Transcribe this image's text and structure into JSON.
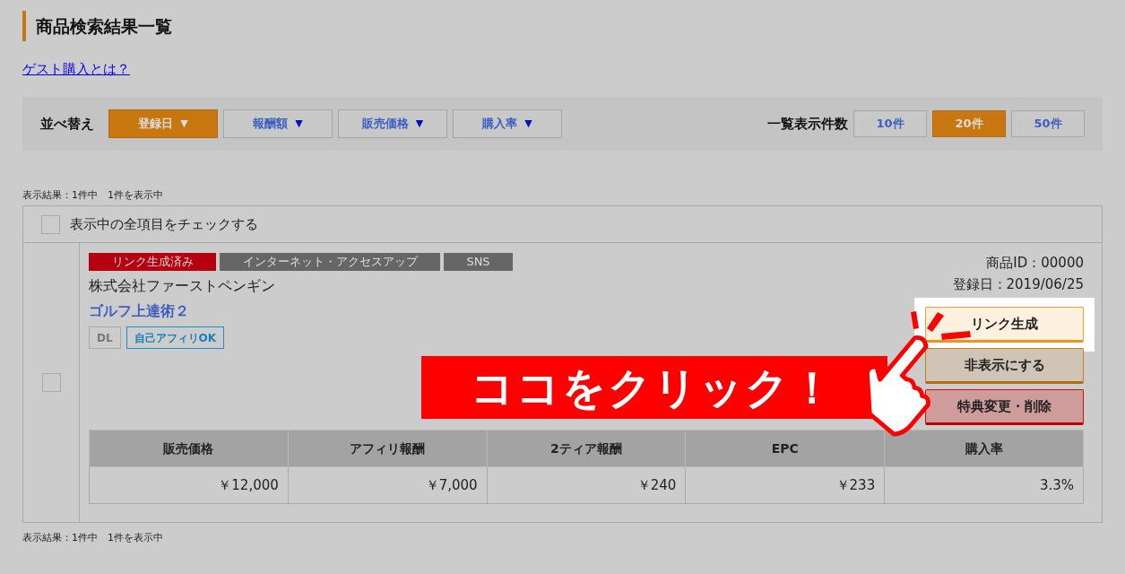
{
  "page_title": "商品検索結果一覧",
  "guest_link": "ゲスト購入とは？",
  "sort": {
    "label": "並べ替え",
    "options": [
      {
        "label": "登録日",
        "selected": true
      },
      {
        "label": "報酬額",
        "selected": false
      },
      {
        "label": "販売価格",
        "selected": false
      },
      {
        "label": "購入率",
        "selected": false
      }
    ],
    "arrow": "▼"
  },
  "per_page": {
    "label": "一覧表示件数",
    "options": [
      {
        "label": "10件",
        "selected": false
      },
      {
        "label": "20件",
        "selected": true
      },
      {
        "label": "50件",
        "selected": false
      }
    ]
  },
  "result_summary_top": "表示結果：1件中　1件を表示中",
  "select_all": {
    "label": "表示中の全項目をチェックする",
    "checked": false
  },
  "item": {
    "checked": false,
    "tags": [
      {
        "label": "リンク生成済み",
        "color": "#b4000f"
      },
      {
        "label": "インターネット・アクセスアップ",
        "color": "#666666"
      },
      {
        "label": "SNS",
        "color": "#666666"
      }
    ],
    "company": "株式会社ファーストペンギン",
    "product_name": "ゴルフ上達術２",
    "badges": [
      {
        "label": "DL",
        "kind": "plain"
      },
      {
        "label": "自己アフィリOK",
        "kind": "outlined"
      }
    ],
    "product_id": "商品ID：00000",
    "registered": "登録日：2019/06/25",
    "actions": [
      {
        "label": "リンク生成",
        "kind": "generate",
        "highlighted": true
      },
      {
        "label": "非表示にする",
        "kind": "hide",
        "highlighted": false
      },
      {
        "label": "特典変更・削除",
        "kind": "delete",
        "highlighted": false
      }
    ],
    "stats": {
      "columns": [
        "販売価格",
        "アフィリ報酬",
        "2ティア報酬",
        "EPC",
        "購入率"
      ],
      "values": [
        "￥12,000",
        "￥7,000",
        "￥240",
        "￥233",
        "3.3%"
      ]
    }
  },
  "result_summary_bottom": "表示結果：1件中　1件を表示中",
  "callout": "ココをクリック！"
}
